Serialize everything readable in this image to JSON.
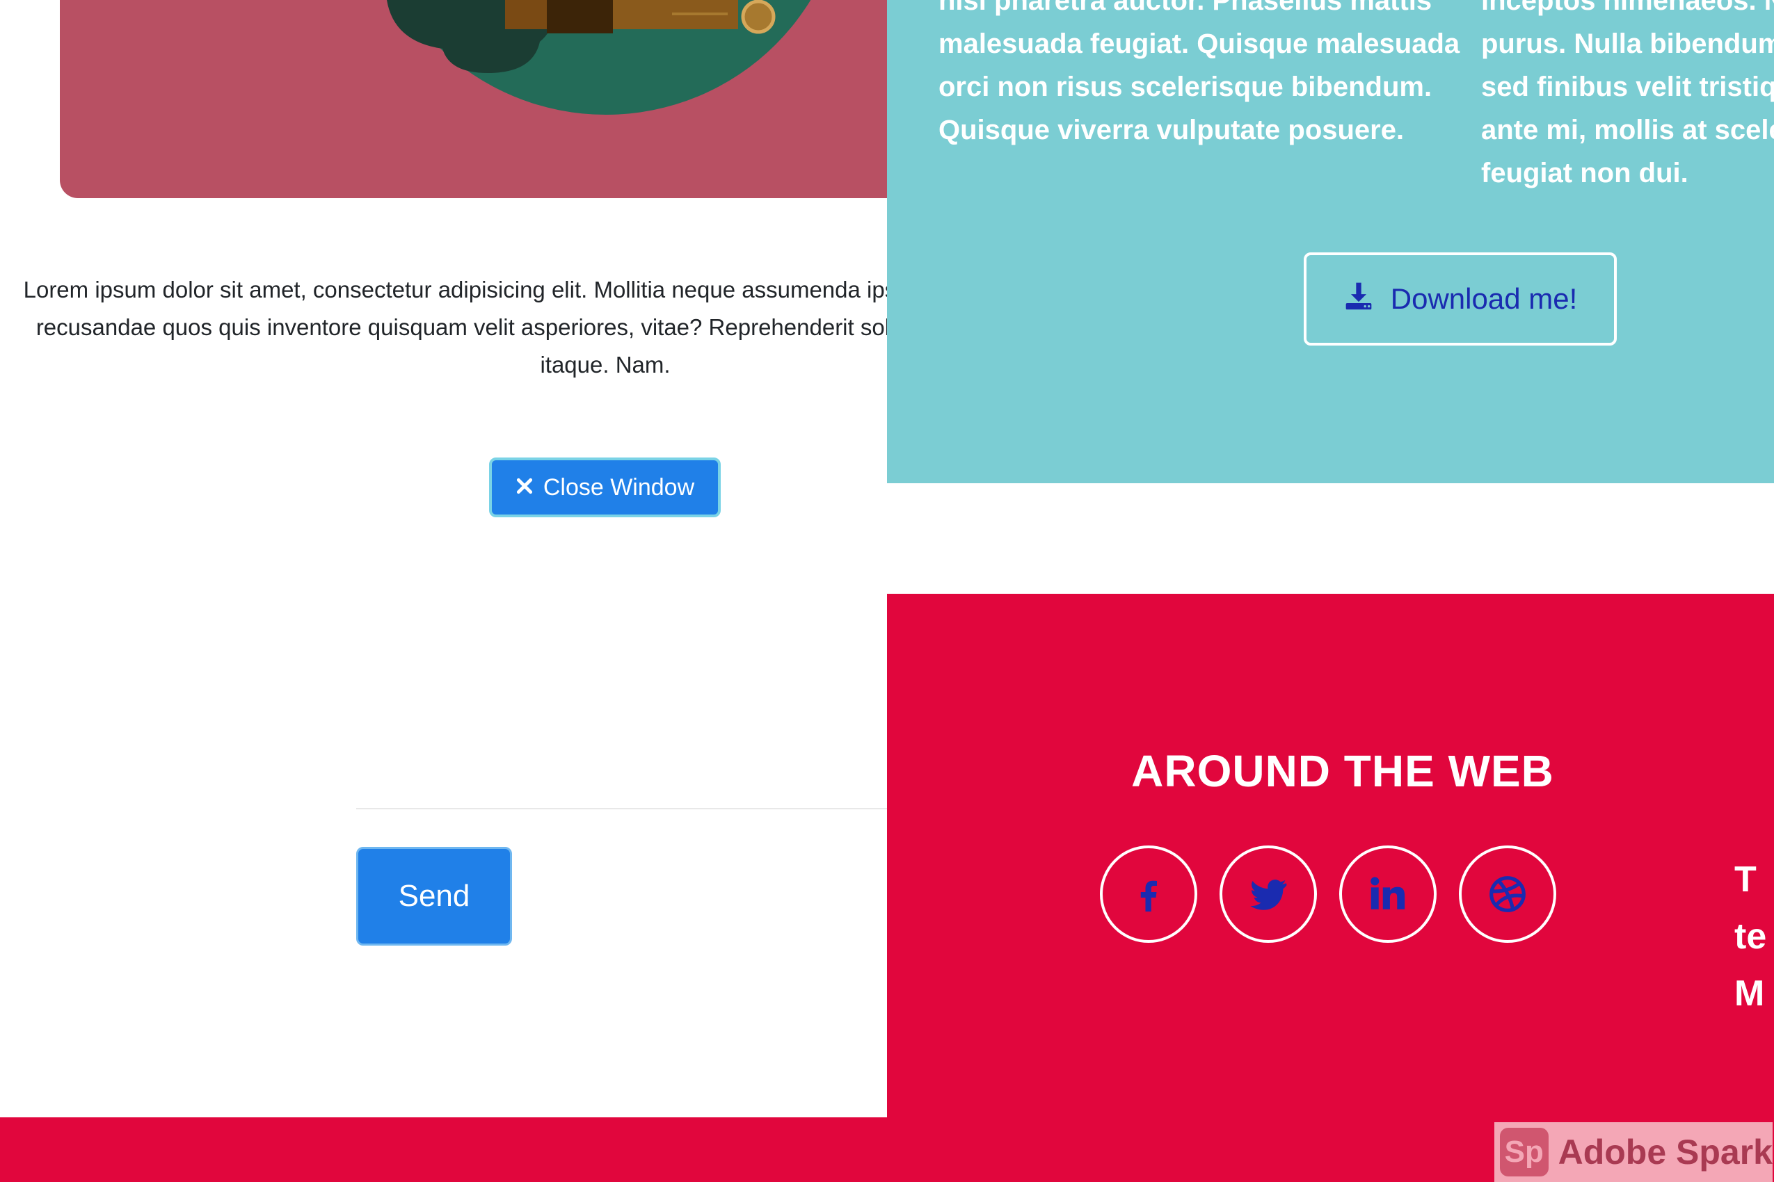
{
  "about": {
    "col1_lines": [
      "nisi pharetra auctor. Phasellus mattis",
      "malesuada feugiat. Quisque malesuada",
      "orci non risus scelerisque bibendum.",
      "Quisque viverra vulputate posuere."
    ],
    "col2_lines": [
      "inceptos himenaeos. Nu",
      "purus. Nulla bibendum r",
      "sed finibus velit tristique",
      "ante mi, mollis at sceleri",
      "feugiat non dui."
    ],
    "download_label": "Download me!",
    "download_icon": "download-icon"
  },
  "modal": {
    "description": "Lorem ipsum dolor sit amet, consectetur adipisicing elit. Mollitia neque assumenda ipsam nihil, molestias magnam, recusandae quos quis inventore quisquam velit asperiores, vitae? Reprehenderit soluta, eos quod consequuntur itaque. Nam.",
    "close_label": "Close Window",
    "close_icon": "close-icon"
  },
  "contact": {
    "send_label": "Send"
  },
  "footer": {
    "around_title": "AROUND THE WEB",
    "social": [
      {
        "name": "facebook-icon",
        "glyph": "f"
      },
      {
        "name": "twitter-icon"
      },
      {
        "name": "linkedin-icon",
        "glyph": "in"
      },
      {
        "name": "dribbble-icon"
      }
    ],
    "edge_lines": [
      "T",
      "te",
      "M"
    ]
  },
  "watermark": {
    "logo_text": "Sp",
    "label": "Adobe Spark"
  },
  "colors": {
    "teal": "#7bcdd3",
    "red": "#e1063d",
    "primary": "#2080e8",
    "icon_blue": "#1a2bb0",
    "hero": "#b85063"
  }
}
